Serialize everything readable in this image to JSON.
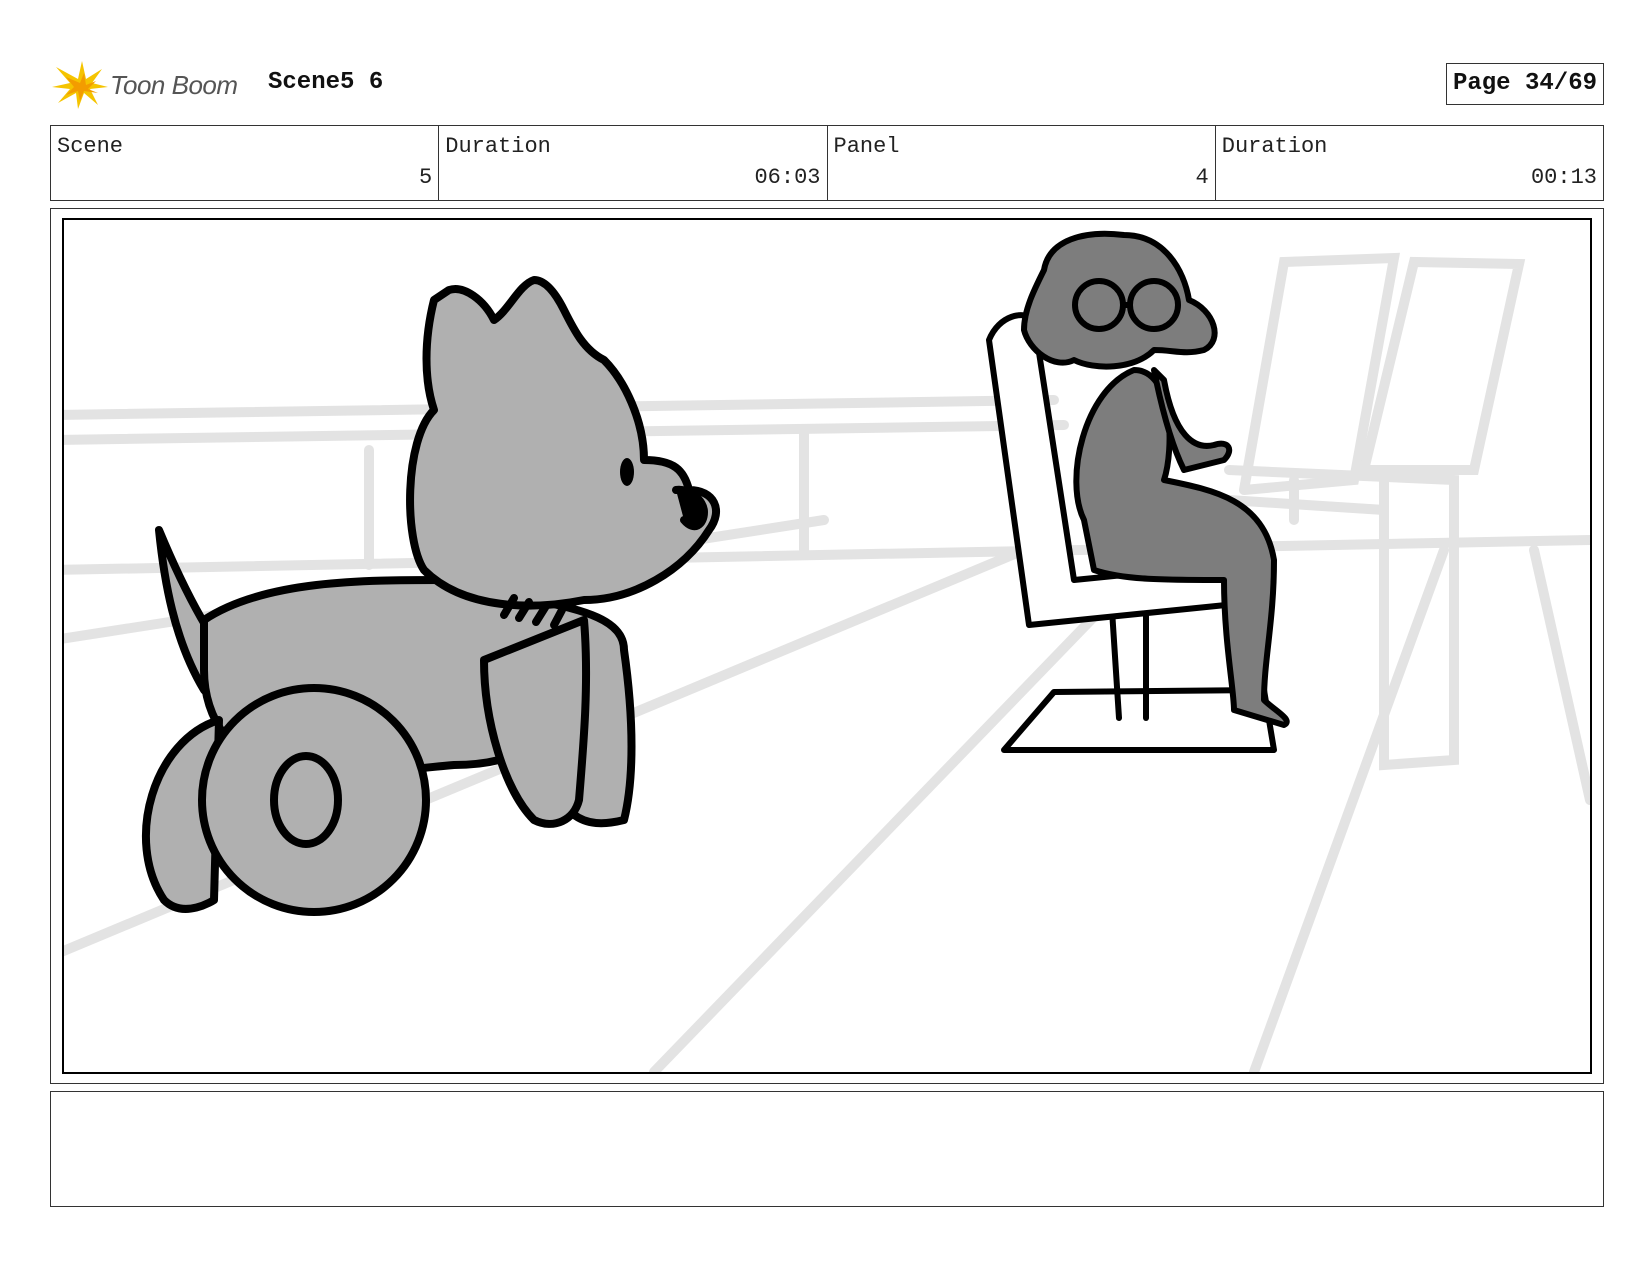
{
  "header": {
    "logo_text": "Toon Boom",
    "scene_title": "Scene5 6",
    "page_label": "Page 34/69"
  },
  "info": {
    "scene_label": "Scene",
    "scene_value": "5",
    "scene_duration_label": "Duration",
    "scene_duration_value": "06:03",
    "panel_label": "Panel",
    "panel_value": "4",
    "panel_duration_label": "Duration",
    "panel_duration_value": "00:13"
  },
  "notes": {
    "text": ""
  },
  "colors": {
    "logo_yellow": "#f5c400",
    "logo_orange": "#f39c00",
    "dog_fill": "#b0b0b0",
    "person_fill": "#7d7d7d",
    "background_lines": "#e3e3e3"
  }
}
